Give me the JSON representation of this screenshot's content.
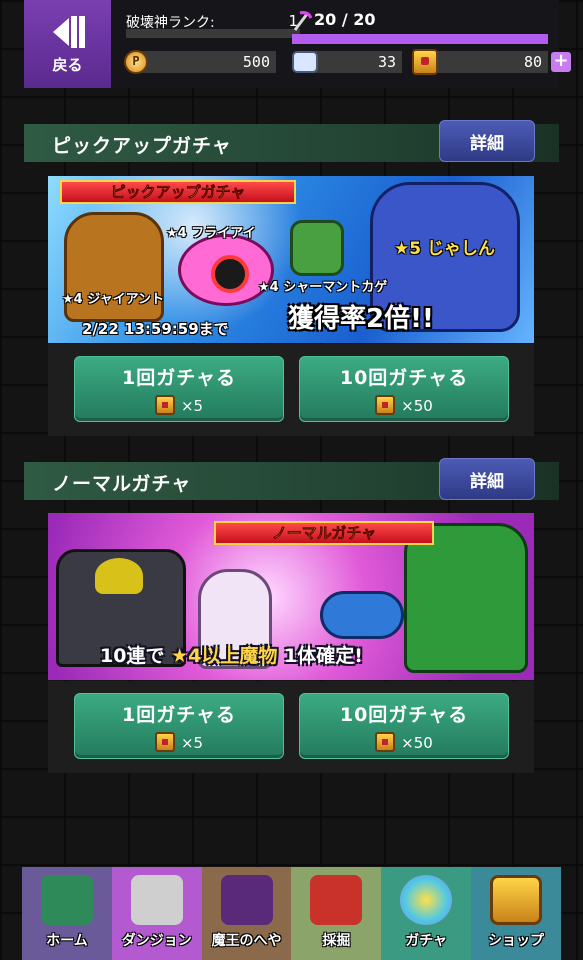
{
  "header": {
    "back_label": "戻る",
    "rank_label": "破壊神ランク:",
    "rank_value": "1",
    "stamina_text": "20 / 20",
    "stamina_fraction": 1.0,
    "points": "500",
    "tickets": "33",
    "medals": "80",
    "plus_symbol": "+"
  },
  "pickup": {
    "title": "ピックアップガチャ",
    "detail_label": "詳細",
    "banner": {
      "tag": "ピックアップガチャ",
      "monster_giant": "★4 ジャイアント",
      "monster_eye": "★4 フライアイ",
      "monster_lizard": "★4 シャーマントカゲ",
      "monster_dragon": "★5 じゃしん",
      "deadline": "2/22 13:59:59まで",
      "rate_text": "獲得率2倍!!"
    },
    "single": {
      "label": "1回ガチャる",
      "cost": "×5"
    },
    "ten": {
      "label": "10回ガチャる",
      "cost": "×50"
    }
  },
  "normal": {
    "title": "ノーマルガチャ",
    "detail_label": "詳細",
    "banner": {
      "tag": "ノーマルガチャ",
      "confirm_prefix": "10連で",
      "confirm_highlight": "★4以上魔物",
      "confirm_suffix": "1体確定!"
    },
    "single": {
      "label": "1回ガチャる",
      "cost": "×5"
    },
    "ten": {
      "label": "10回ガチャる",
      "cost": "×50"
    }
  },
  "nav": [
    {
      "label": "ホーム",
      "icon": "dragon-icon",
      "color": "#6b5a9a"
    },
    {
      "label": "ダンジョン",
      "icon": "swords-icon",
      "color": "#b35ad0"
    },
    {
      "label": "魔王のへや",
      "icon": "demon-lord-icon",
      "color": "#8a6a4a"
    },
    {
      "label": "採掘",
      "icon": "miner-icon",
      "color": "#8aa46a"
    },
    {
      "label": "ガチャ",
      "icon": "gacha-orb-icon",
      "color": "#3a9a82"
    },
    {
      "label": "ショップ",
      "icon": "shop-medal-icon",
      "color": "#3a8a9a"
    }
  ]
}
